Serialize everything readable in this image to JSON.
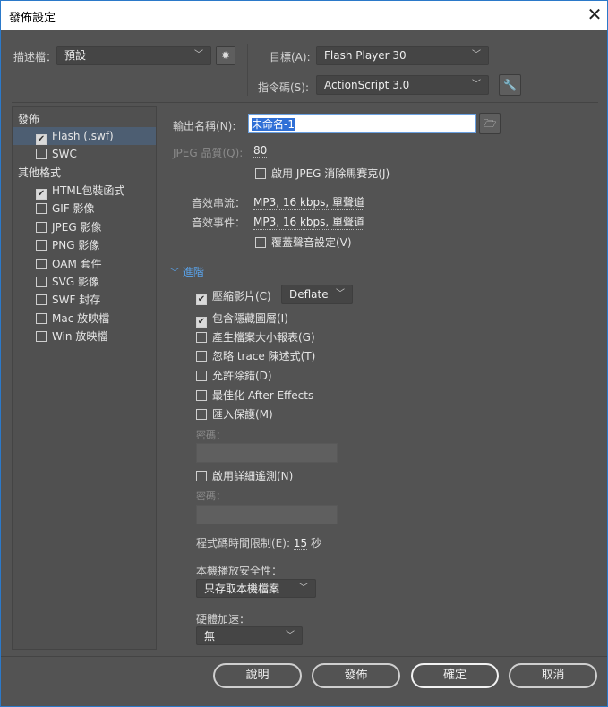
{
  "title": "發佈設定",
  "profile": {
    "label": "描述檔：",
    "value": "預設"
  },
  "target": {
    "label": "目標(A):",
    "value": "Flash Player 30"
  },
  "script": {
    "label": "指令碼(S):",
    "value": "ActionScript 3.0"
  },
  "left": {
    "publish_header": "發佈",
    "publish_items": [
      {
        "label": "Flash (.swf)",
        "checked": true,
        "selected": true
      },
      {
        "label": "SWC",
        "checked": false
      }
    ],
    "other_header": "其他格式",
    "other_items": [
      {
        "label": "HTML包裝函式",
        "checked": true
      },
      {
        "label": "GIF 影像",
        "checked": false
      },
      {
        "label": "JPEG 影像",
        "checked": false
      },
      {
        "label": "PNG 影像",
        "checked": false
      },
      {
        "label": "OAM 套件",
        "checked": false
      },
      {
        "label": "SVG 影像",
        "checked": false
      },
      {
        "label": "SWF 封存",
        "checked": false
      },
      {
        "label": "Mac 放映檔",
        "checked": false
      },
      {
        "label": "Win 放映檔",
        "checked": false
      }
    ]
  },
  "output": {
    "label": "輸出名稱(N):",
    "value": "未命名-1"
  },
  "jpeg": {
    "label": "JPEG 品質(Q):",
    "value": "80",
    "deblock": "啟用 JPEG 消除馬賽克(J)"
  },
  "audio": {
    "stream_label": "音效串流：",
    "stream_value": "MP3, 16 kbps, 單聲道",
    "event_label": "音效事件：",
    "event_value": "MP3, 16 kbps, 單聲道",
    "override": "覆蓋聲音設定(V)"
  },
  "advanced": {
    "header": "進階",
    "compress": "壓縮影片(C)",
    "compress_mode": "Deflate",
    "include_hidden": "包含隱藏圖層(I)",
    "size_report": "產生檔案大小報表(G)",
    "omit_trace": "忽略 trace 陳述式(T)",
    "permit_debug": "允許除錯(D)",
    "optimize_ae": "最佳化 After Effects",
    "protect_import": "匯入保護(M)",
    "password_label": "密碼：",
    "telemetry": "啟用詳細遙測(N)",
    "password2_label": "密碼：",
    "script_time_label": "程式碼時間限制(E):",
    "script_time_value": "15",
    "script_time_unit": "秒",
    "local_security_label": "本機播放安全性：",
    "local_security_value": "只存取本機檔案",
    "hw_accel_label": "硬體加速：",
    "hw_accel_value": "無"
  },
  "buttons": {
    "help": "說明",
    "publish": "發佈",
    "ok": "確定",
    "cancel": "取消"
  }
}
